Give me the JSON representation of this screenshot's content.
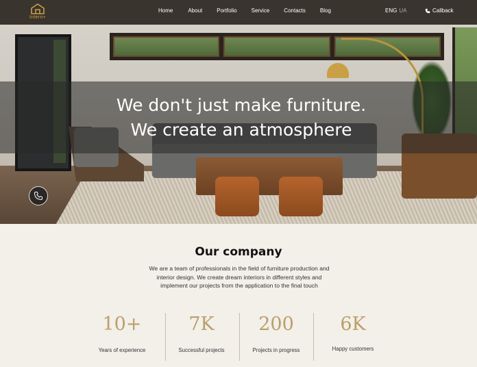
{
  "nav": {
    "logo_text": "Intern+",
    "menu": [
      "Home",
      "About",
      "Portfolio",
      "Service",
      "Contacts",
      "Blog"
    ],
    "lang_active": "ENG",
    "lang_other": "UA",
    "callback_label": "Callback"
  },
  "hero": {
    "title_line1": "We don't just make furniture.",
    "title_line2": "We create an atmosphere"
  },
  "company": {
    "title": "Our company",
    "description": "We are a team of professionals in the field of furniture production and interior design. We create dream interiors in different styles and implement our projects from the application to the final touch"
  },
  "stats": [
    {
      "value": "10+",
      "label": "Years of experience"
    },
    {
      "value": "7K",
      "label": "Successful projects"
    },
    {
      "value": "200",
      "label": "Projects in progress"
    },
    {
      "value": "6K",
      "label": "Happy customers"
    }
  ],
  "colors": {
    "accent": "#b9a06a",
    "logo": "#c9a045",
    "background": "#f3efe9"
  },
  "icons": {
    "logo": "house-icon",
    "callback": "phone-icon",
    "floating": "phone-icon"
  }
}
